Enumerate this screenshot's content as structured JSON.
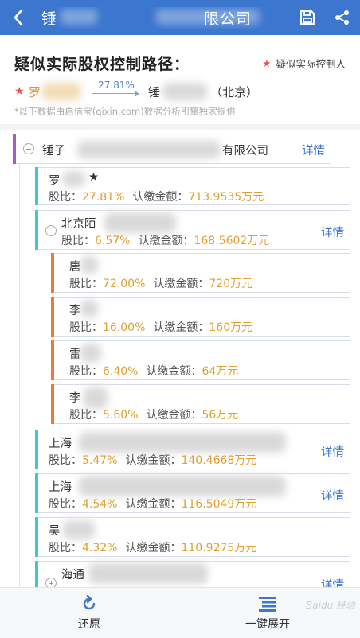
{
  "topbar": {
    "title_left": "锤",
    "title_right": "限公司",
    "back_icon": "back-arrow-icon",
    "save_icon": "save-icon",
    "share_icon": "share-icon",
    "bg": "#3c76cf"
  },
  "header": {
    "title": "疑似实际股权控制路径：",
    "legend_star": "★",
    "legend_label": "疑似实际控制人",
    "path_from": "罗",
    "path_pct": "27.81%",
    "path_to": "锤",
    "path_to_suffix": "（北京）",
    "note": "*以下数据由启信宝(qixin.com)数据分析引擎独家提供"
  },
  "tree": {
    "detail_label": "详情",
    "ratio_label": "股比：",
    "amount_label": "认缴金额：",
    "root": {
      "name_left": "锤子",
      "name_right": "有限公司"
    },
    "children": [
      {
        "name": "罗",
        "ratio": "27.81%",
        "amount": "713.9535万元",
        "star": "★"
      },
      {
        "name": "北京陌",
        "ratio": "6.57%",
        "amount": "168.5602万元"
      },
      {
        "name": "唐",
        "ratio": "72.00%",
        "amount": "720万元"
      },
      {
        "name": "李",
        "ratio": "16.00%",
        "amount": "160万元"
      },
      {
        "name": "雷",
        "ratio": "6.40%",
        "amount": "64万元"
      },
      {
        "name": "李",
        "ratio": "5.60%",
        "amount": "56万元"
      },
      {
        "name": "上海",
        "ratio": "5.47%",
        "amount": "140.4668万元"
      },
      {
        "name": "上海",
        "ratio": "4.54%",
        "amount": "116.5049万元"
      },
      {
        "name": "吴",
        "ratio": "4.32%",
        "amount": "110.9275万元"
      },
      {
        "name": "海通"
      }
    ]
  },
  "bottombar": {
    "restore_label": "还原",
    "restore_icon": "refresh-icon",
    "expand_label": "一键展开",
    "expand_icon": "list-expand-icon",
    "watermark": "Baidu 经验"
  },
  "colors": {
    "accent": "#3c76cf",
    "star": "#e8544a",
    "value": "#e0a030",
    "bar_purple": "#a35ec0",
    "bar_cyan": "#3ec6d6",
    "bar_orange": "#e9793c"
  }
}
